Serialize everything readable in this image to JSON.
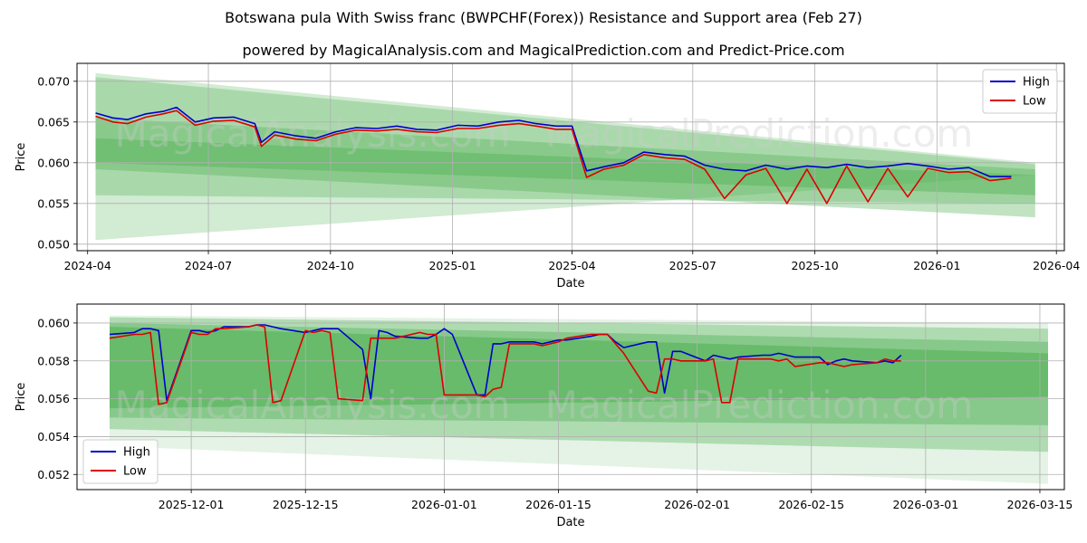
{
  "titles": {
    "line1": "Botswana pula With Swiss franc (BWPCHF(Forex)) Resistance and Support area (Feb 27)",
    "line2": "powered by MagicalAnalysis.com and MagicalPrediction.com and Predict-Price.com"
  },
  "watermarks": [
    "MagicalAnalysis.com",
    "MagicalPrediction.com"
  ],
  "colors": {
    "high": "#0000cc",
    "low": "#dd0000",
    "band": "#4caf50",
    "grid": "#b0b0b0"
  },
  "chart_data": [
    {
      "type": "line",
      "xlabel": "Date",
      "ylabel": "Price",
      "xlim": [
        "2024-03-24",
        "2026-04-07"
      ],
      "ylim": [
        0.0492,
        0.0722
      ],
      "grid": true,
      "legend_placement": "top-right",
      "x_ticks": [
        "2024-04",
        "2024-07",
        "2024-10",
        "2025-01",
        "2025-04",
        "2025-07",
        "2025-10",
        "2026-01",
        "2026-04"
      ],
      "y_ticks": [
        "0.050",
        "0.055",
        "0.060",
        "0.065",
        "0.070"
      ],
      "bands": [
        {
          "x": [
            "2024-04-07",
            "2026-03-16"
          ],
          "upper": [
            0.071,
            0.06
          ],
          "lower": [
            0.0505,
            0.0585
          ],
          "opacity": 0.25
        },
        {
          "x": [
            "2024-04-07",
            "2026-03-16"
          ],
          "upper": [
            0.0705,
            0.0598
          ],
          "lower": [
            0.056,
            0.055
          ],
          "opacity": 0.3
        },
        {
          "x": [
            "2024-04-07",
            "2026-03-16"
          ],
          "upper": [
            0.0655,
            0.0592
          ],
          "lower": [
            0.0592,
            0.0533
          ],
          "opacity": 0.35
        },
        {
          "x": [
            "2024-04-07",
            "2026-03-16"
          ],
          "upper": [
            0.063,
            0.0585
          ],
          "lower": [
            0.06,
            0.056
          ],
          "opacity": 0.4
        }
      ],
      "series": [
        {
          "name": "High",
          "x": [
            "2024-04-07",
            "2024-04-20",
            "2024-05-01",
            "2024-05-15",
            "2024-05-28",
            "2024-06-07",
            "2024-06-21",
            "2024-07-05",
            "2024-07-20",
            "2024-08-05",
            "2024-08-10",
            "2024-08-20",
            "2024-09-05",
            "2024-09-20",
            "2024-10-05",
            "2024-10-20",
            "2024-11-05",
            "2024-11-20",
            "2024-12-05",
            "2024-12-20",
            "2025-01-05",
            "2025-01-20",
            "2025-02-05",
            "2025-02-20",
            "2025-03-05",
            "2025-03-20",
            "2025-04-01",
            "2025-04-05",
            "2025-04-12",
            "2025-04-25",
            "2025-05-10",
            "2025-05-25",
            "2025-06-10",
            "2025-06-25",
            "2025-07-10",
            "2025-07-25",
            "2025-08-10",
            "2025-08-25",
            "2025-09-10",
            "2025-09-25",
            "2025-10-10",
            "2025-10-25",
            "2025-11-10",
            "2025-11-25",
            "2025-12-10",
            "2025-12-25",
            "2026-01-10",
            "2026-01-25",
            "2026-02-10",
            "2026-02-26"
          ],
          "values": [
            0.0661,
            0.0655,
            0.0653,
            0.066,
            0.0663,
            0.0668,
            0.065,
            0.0655,
            0.0656,
            0.0648,
            0.0625,
            0.0638,
            0.0633,
            0.063,
            0.0638,
            0.0643,
            0.0642,
            0.0645,
            0.0641,
            0.064,
            0.0646,
            0.0645,
            0.065,
            0.0652,
            0.0648,
            0.0645,
            0.0645,
            0.0625,
            0.059,
            0.0595,
            0.06,
            0.0613,
            0.061,
            0.0608,
            0.0597,
            0.0592,
            0.059,
            0.0597,
            0.0592,
            0.0596,
            0.0594,
            0.0598,
            0.0594,
            0.0596,
            0.0599,
            0.0596,
            0.0592,
            0.0594,
            0.0583,
            0.0583
          ]
        },
        {
          "name": "Low",
          "x": [
            "2024-04-07",
            "2024-04-20",
            "2024-05-01",
            "2024-05-15",
            "2024-05-28",
            "2024-06-07",
            "2024-06-21",
            "2024-07-05",
            "2024-07-20",
            "2024-08-05",
            "2024-08-10",
            "2024-08-20",
            "2024-09-05",
            "2024-09-20",
            "2024-10-05",
            "2024-10-20",
            "2024-11-05",
            "2024-11-20",
            "2024-12-05",
            "2024-12-20",
            "2025-01-05",
            "2025-01-20",
            "2025-02-05",
            "2025-02-20",
            "2025-03-05",
            "2025-03-20",
            "2025-04-01",
            "2025-04-05",
            "2025-04-12",
            "2025-04-25",
            "2025-05-10",
            "2025-05-25",
            "2025-06-10",
            "2025-06-25",
            "2025-07-10",
            "2025-07-25",
            "2025-08-10",
            "2025-08-25",
            "2025-09-10",
            "2025-09-25",
            "2025-10-10",
            "2025-10-25",
            "2025-11-10",
            "2025-11-25",
            "2025-12-10",
            "2025-12-25",
            "2026-01-10",
            "2026-01-25",
            "2026-02-10",
            "2026-02-26"
          ],
          "values": [
            0.0657,
            0.065,
            0.0648,
            0.0656,
            0.066,
            0.0664,
            0.0646,
            0.0651,
            0.0652,
            0.0644,
            0.062,
            0.0634,
            0.0629,
            0.0627,
            0.0635,
            0.064,
            0.0639,
            0.0641,
            0.0638,
            0.0637,
            0.0642,
            0.0642,
            0.0646,
            0.0648,
            0.0645,
            0.0641,
            0.0641,
            0.062,
            0.0582,
            0.0592,
            0.0597,
            0.061,
            0.0606,
            0.0604,
            0.0592,
            0.0556,
            0.0585,
            0.0593,
            0.055,
            0.0592,
            0.055,
            0.0596,
            0.0552,
            0.0593,
            0.0558,
            0.0593,
            0.0588,
            0.0589,
            0.0578,
            0.0581
          ]
        }
      ]
    },
    {
      "type": "line",
      "xlabel": "Date",
      "ylabel": "Price",
      "xlim": [
        "2025-11-17",
        "2026-03-18"
      ],
      "ylim": [
        0.0512,
        0.061
      ],
      "grid": true,
      "legend_placement": "bottom-left",
      "x_ticks": [
        "2025-12-01",
        "2025-12-15",
        "2026-01-01",
        "2026-01-15",
        "2026-02-01",
        "2026-02-15",
        "2026-03-01",
        "2026-03-15"
      ],
      "y_ticks": [
        "0.052",
        "0.054",
        "0.056",
        "0.058",
        "0.060"
      ],
      "bands": [
        {
          "x": [
            "2025-11-21",
            "2026-03-16"
          ],
          "upper": [
            0.0604,
            0.06
          ],
          "lower": [
            0.0535,
            0.0515
          ],
          "opacity": 0.15
        },
        {
          "x": [
            "2025-11-21",
            "2026-03-16"
          ],
          "upper": [
            0.0603,
            0.0597
          ],
          "lower": [
            0.0544,
            0.0532
          ],
          "opacity": 0.35
        },
        {
          "x": [
            "2025-11-21",
            "2026-03-16"
          ],
          "upper": [
            0.06,
            0.059
          ],
          "lower": [
            0.055,
            0.0546
          ],
          "opacity": 0.4
        },
        {
          "x": [
            "2025-11-21",
            "2026-03-16"
          ],
          "upper": [
            0.0598,
            0.0584
          ],
          "lower": [
            0.0555,
            0.0561
          ],
          "opacity": 0.55
        }
      ],
      "series": [
        {
          "name": "High",
          "x": [
            "2025-11-21",
            "2025-11-24",
            "2025-11-25",
            "2025-11-26",
            "2025-11-27",
            "2025-11-28",
            "2025-12-01",
            "2025-12-02",
            "2025-12-03",
            "2025-12-04",
            "2025-12-05",
            "2025-12-08",
            "2025-12-09",
            "2025-12-10",
            "2025-12-11",
            "2025-12-12",
            "2025-12-15",
            "2025-12-16",
            "2025-12-17",
            "2025-12-18",
            "2025-12-19",
            "2025-12-22",
            "2025-12-23",
            "2025-12-24",
            "2025-12-25",
            "2025-12-26",
            "2025-12-29",
            "2025-12-30",
            "2025-12-31",
            "2026-01-01",
            "2026-01-02",
            "2026-01-05",
            "2026-01-06",
            "2026-01-07",
            "2026-01-08",
            "2026-01-09",
            "2026-01-12",
            "2026-01-13",
            "2026-01-14",
            "2026-01-15",
            "2026-01-16",
            "2026-01-19",
            "2026-01-20",
            "2026-01-21",
            "2026-01-22",
            "2026-01-23",
            "2026-01-26",
            "2026-01-27",
            "2026-01-28",
            "2026-01-29",
            "2026-01-30",
            "2026-02-02",
            "2026-02-03",
            "2026-02-04",
            "2026-02-05",
            "2026-02-06",
            "2026-02-09",
            "2026-02-10",
            "2026-02-11",
            "2026-02-12",
            "2026-02-13",
            "2026-02-16",
            "2026-02-17",
            "2026-02-18",
            "2026-02-19",
            "2026-02-20",
            "2026-02-23",
            "2026-02-24",
            "2026-02-25",
            "2026-02-26"
          ],
          "values": [
            0.0594,
            0.0595,
            0.0597,
            0.0597,
            0.0596,
            0.0559,
            0.0596,
            0.0596,
            0.0595,
            0.0596,
            0.0598,
            0.0598,
            0.0599,
            0.0599,
            0.0598,
            0.0597,
            0.0595,
            0.0596,
            0.0597,
            0.0597,
            0.0597,
            0.0586,
            0.056,
            0.0596,
            0.0595,
            0.0593,
            0.0592,
            0.0592,
            0.0594,
            0.0597,
            0.0594,
            0.0562,
            0.0562,
            0.0589,
            0.0589,
            0.059,
            0.059,
            0.0589,
            0.059,
            0.0591,
            0.0591,
            0.0593,
            0.0594,
            0.0594,
            0.059,
            0.0587,
            0.059,
            0.059,
            0.0563,
            0.0585,
            0.0585,
            0.058,
            0.0583,
            0.0582,
            0.0581,
            0.0582,
            0.0583,
            0.0583,
            0.0584,
            0.0583,
            0.0582,
            0.0582,
            0.0578,
            0.058,
            0.0581,
            0.058,
            0.0579,
            0.058,
            0.0579,
            0.0583
          ]
        },
        {
          "name": "Low",
          "x": [
            "2025-11-21",
            "2025-11-24",
            "2025-11-25",
            "2025-11-26",
            "2025-11-27",
            "2025-11-28",
            "2025-12-01",
            "2025-12-02",
            "2025-12-03",
            "2025-12-04",
            "2025-12-05",
            "2025-12-08",
            "2025-12-09",
            "2025-12-10",
            "2025-12-11",
            "2025-12-12",
            "2025-12-15",
            "2025-12-16",
            "2025-12-17",
            "2025-12-18",
            "2025-12-19",
            "2025-12-22",
            "2025-12-23",
            "2025-12-24",
            "2025-12-25",
            "2025-12-26",
            "2025-12-29",
            "2025-12-30",
            "2025-12-31",
            "2026-01-01",
            "2026-01-02",
            "2026-01-05",
            "2026-01-06",
            "2026-01-07",
            "2026-01-08",
            "2026-01-09",
            "2026-01-12",
            "2026-01-13",
            "2026-01-14",
            "2026-01-15",
            "2026-01-16",
            "2026-01-19",
            "2026-01-20",
            "2026-01-21",
            "2026-01-22",
            "2026-01-23",
            "2026-01-26",
            "2026-01-27",
            "2026-01-28",
            "2026-01-29",
            "2026-01-30",
            "2026-02-02",
            "2026-02-03",
            "2026-02-04",
            "2026-02-05",
            "2026-02-06",
            "2026-02-09",
            "2026-02-10",
            "2026-02-11",
            "2026-02-12",
            "2026-02-13",
            "2026-02-16",
            "2026-02-17",
            "2026-02-18",
            "2026-02-19",
            "2026-02-20",
            "2026-02-23",
            "2026-02-24",
            "2026-02-25",
            "2026-02-26"
          ],
          "values": [
            0.0592,
            0.0594,
            0.0594,
            0.0595,
            0.0557,
            0.0558,
            0.0595,
            0.0594,
            0.0594,
            0.0597,
            0.0597,
            0.0598,
            0.0599,
            0.0598,
            0.0558,
            0.0559,
            0.0596,
            0.0595,
            0.0596,
            0.0595,
            0.056,
            0.0559,
            0.0592,
            0.0592,
            0.0592,
            0.0592,
            0.0595,
            0.0594,
            0.0594,
            0.0562,
            0.0562,
            0.0562,
            0.0561,
            0.0565,
            0.0566,
            0.0589,
            0.0589,
            0.0588,
            0.0589,
            0.059,
            0.0592,
            0.0594,
            0.0594,
            0.0594,
            0.0589,
            0.0584,
            0.0564,
            0.0563,
            0.0581,
            0.0581,
            0.058,
            0.058,
            0.0581,
            0.0558,
            0.0558,
            0.0581,
            0.0581,
            0.0581,
            0.058,
            0.0581,
            0.0577,
            0.0579,
            0.0579,
            0.0578,
            0.0577,
            0.0578,
            0.0579,
            0.0581,
            0.058,
            0.058
          ]
        }
      ]
    }
  ]
}
